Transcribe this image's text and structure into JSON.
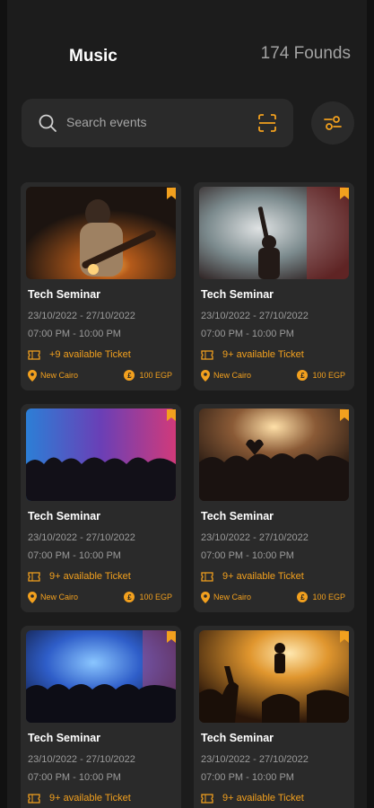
{
  "header": {
    "title": "Music",
    "count": "174 Founds"
  },
  "search": {
    "placeholder": "Search events"
  },
  "accent_color": "#f2a01e",
  "cards": [
    {
      "title": "Tech Seminar",
      "dates": "23/10/2022 - 27/10/2022",
      "times": "07:00 PM - 10:00 PM",
      "tickets": "+9 available Ticket",
      "location": "New Cairo",
      "price": "100 EGP",
      "image": "guitarist-in-studio"
    },
    {
      "title": "Tech Seminar",
      "dates": "23/10/2022 - 27/10/2022",
      "times": "07:00 PM - 10:00 PM",
      "tickets": "9+ available Ticket",
      "location": "New Cairo",
      "price": "100 EGP",
      "image": "singer-in-smoke"
    },
    {
      "title": "Tech Seminar",
      "dates": "23/10/2022 - 27/10/2022",
      "times": "07:00 PM - 10:00 PM",
      "tickets": "9+ available Ticket",
      "location": "New Cairo",
      "price": "100 EGP",
      "image": "concert-crowd-blue"
    },
    {
      "title": "Tech Seminar",
      "dates": "23/10/2022 - 27/10/2022",
      "times": "07:00 PM - 10:00 PM",
      "tickets": "9+ available Ticket",
      "location": "New Cairo",
      "price": "100 EGP",
      "image": "crowd-heart-hands"
    },
    {
      "title": "Tech Seminar",
      "dates": "23/10/2022 - 27/10/2022",
      "times": "07:00 PM - 10:00 PM",
      "tickets": "9+ available Ticket",
      "location": "",
      "price": "",
      "image": "stage-blue-lights"
    },
    {
      "title": "Tech Seminar",
      "dates": "23/10/2022 - 27/10/2022",
      "times": "07:00 PM - 10:00 PM",
      "tickets": "9+ available Ticket",
      "location": "",
      "price": "",
      "image": "guitarist-silhouette"
    }
  ]
}
